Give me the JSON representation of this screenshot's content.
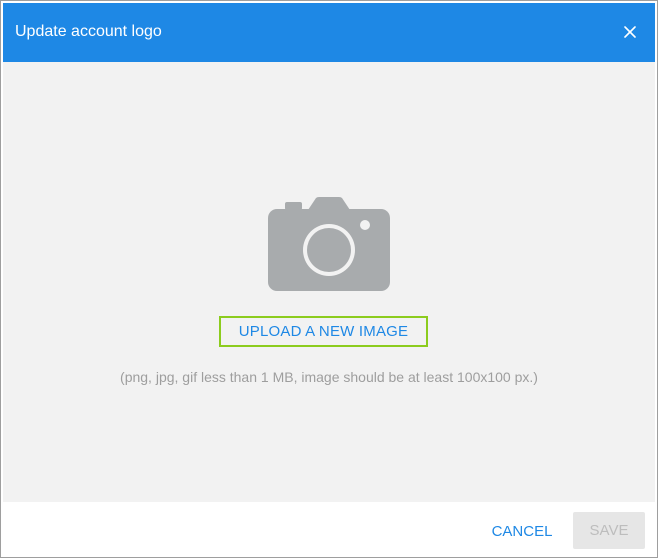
{
  "dialog": {
    "title": "Update account logo",
    "close_icon": "close-icon"
  },
  "upload": {
    "camera_icon": "camera-icon",
    "link_label": "UPLOAD A NEW IMAGE",
    "hint": "(png, jpg, gif less than 1 MB, image should be at least 100x100 px.)"
  },
  "footer": {
    "cancel_label": "CANCEL",
    "save_label": "SAVE",
    "save_disabled": true
  },
  "colors": {
    "header_bg": "#1e88e5",
    "link": "#1e88e5",
    "highlight_border": "#8ccc1e",
    "body_bg": "#f2f2f2",
    "camera": "#a8abad"
  }
}
